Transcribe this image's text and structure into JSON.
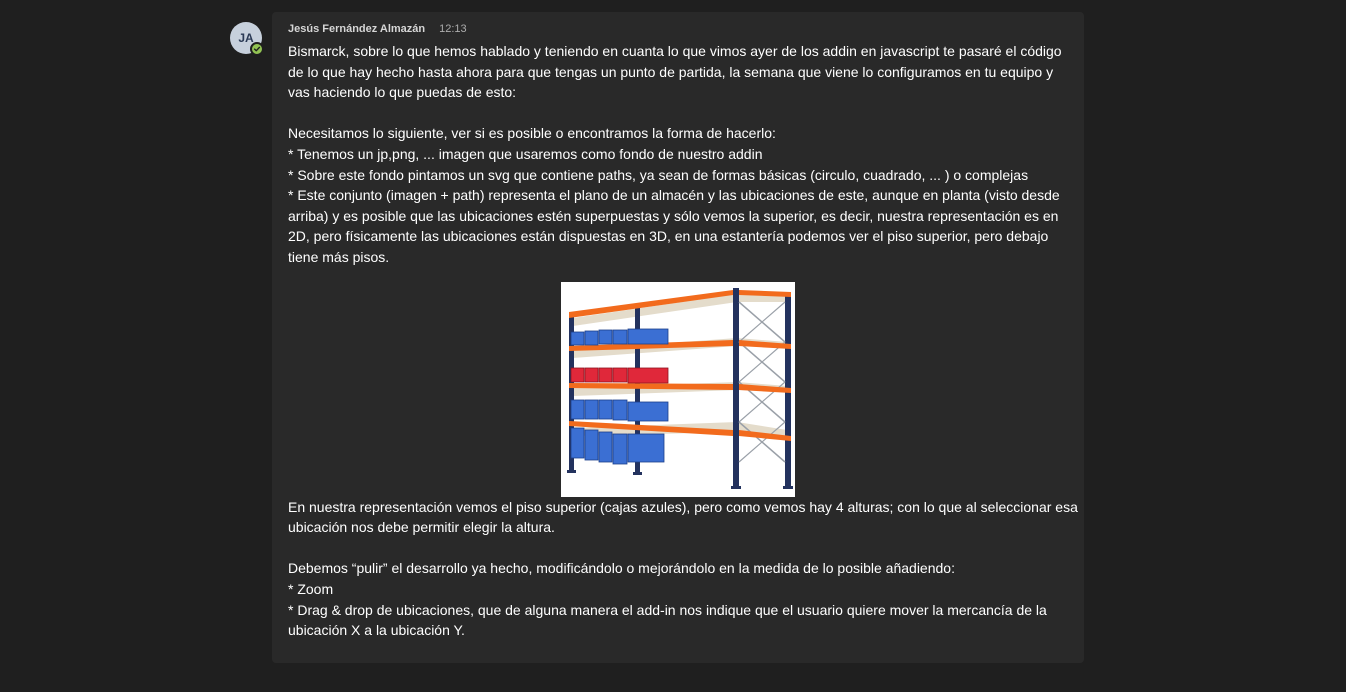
{
  "message": {
    "avatar_initials": "JA",
    "presence_icon": "available-check-icon",
    "sender": "Jesús Fernández Almazán",
    "time": "12:13",
    "intro": "Bismarck, sobre lo que hemos hablado y teniendo en cuanta lo que vimos ayer de los addin en javascript te pasaré el código de lo que hay hecho hasta ahora para que tengas un punto de partida, la semana que viene lo configuramos en tu equipo y vas haciendo lo que puedas de esto:",
    "needs_heading": "Necesitamos lo siguiente, ver si es posible o encontramos la forma de hacerlo:",
    "needs_1": "* Tenemos un jp,png, ... imagen que usaremos como fondo de nuestro addin",
    "needs_2": "* Sobre este fondo pintamos un svg que contiene paths, ya sean de formas básicas (circulo, cuadrado, ... ) o complejas",
    "needs_3": "* Este conjunto (imagen + path) representa el plano de un almacén y las ubicaciones de este, aunque en planta (visto desde arriba) y es posible que las ubicaciones estén superpuestas y sólo vemos la superior, es decir, nuestra representación es en 2D, pero físicamente las ubicaciones están dispuestas en 3D, en una estantería podemos ver el piso superior, pero debajo tiene más pisos.",
    "image_icon": "warehouse-shelving-image",
    "after_image": "En nuestra representación vemos el piso superior (cajas azules), pero como vemos hay 4 alturas; con lo que al seleccionar esa ubicación nos debe permitir elegir la altura.",
    "polish_heading": "Debemos “pulir” el desarrollo ya hecho, modificándolo o mejorándolo en la medida de lo posible añadiendo:",
    "polish_1": "* Zoom",
    "polish_2": "* Drag & drop de ubicaciones, que de alguna manera el add-in nos indique que el usuario quiere mover la mercancía de la ubicación X a la ubicación Y."
  },
  "colors": {
    "page_background": "#1f1f1f",
    "bubble_background": "#292929",
    "text": "#ffffff",
    "presence_available": "#92c353",
    "shelf_frame": "#23325e",
    "shelf_beam": "#f26b1d",
    "box_blue": "#3b6fd3",
    "box_red": "#e0283a"
  }
}
